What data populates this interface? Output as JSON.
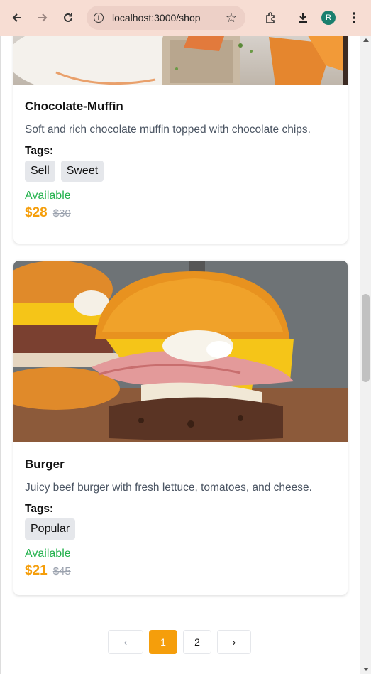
{
  "browser": {
    "url": "localhost:3000/shop",
    "profile_initial": "R"
  },
  "products": [
    {
      "title": "Chocolate-Muffin",
      "description": "Soft and rich chocolate muffin topped with chocolate chips.",
      "tags_label": "Tags:",
      "tags": [
        "Sell",
        "Sweet"
      ],
      "availability": "Available",
      "price": "$28",
      "old_price": "$30"
    },
    {
      "title": "Burger",
      "description": "Juicy beef burger with fresh lettuce, tomatoes, and cheese.",
      "tags_label": "Tags:",
      "tags": [
        "Popular"
      ],
      "availability": "Available",
      "price": "$21",
      "old_price": "$45"
    }
  ],
  "pagination": {
    "prev": "‹",
    "pages": [
      "1",
      "2"
    ],
    "active_page": "1",
    "next": "›"
  },
  "colors": {
    "accent": "#f59e0b",
    "available": "#22b14c",
    "chrome_bg": "#f7ddd3"
  }
}
